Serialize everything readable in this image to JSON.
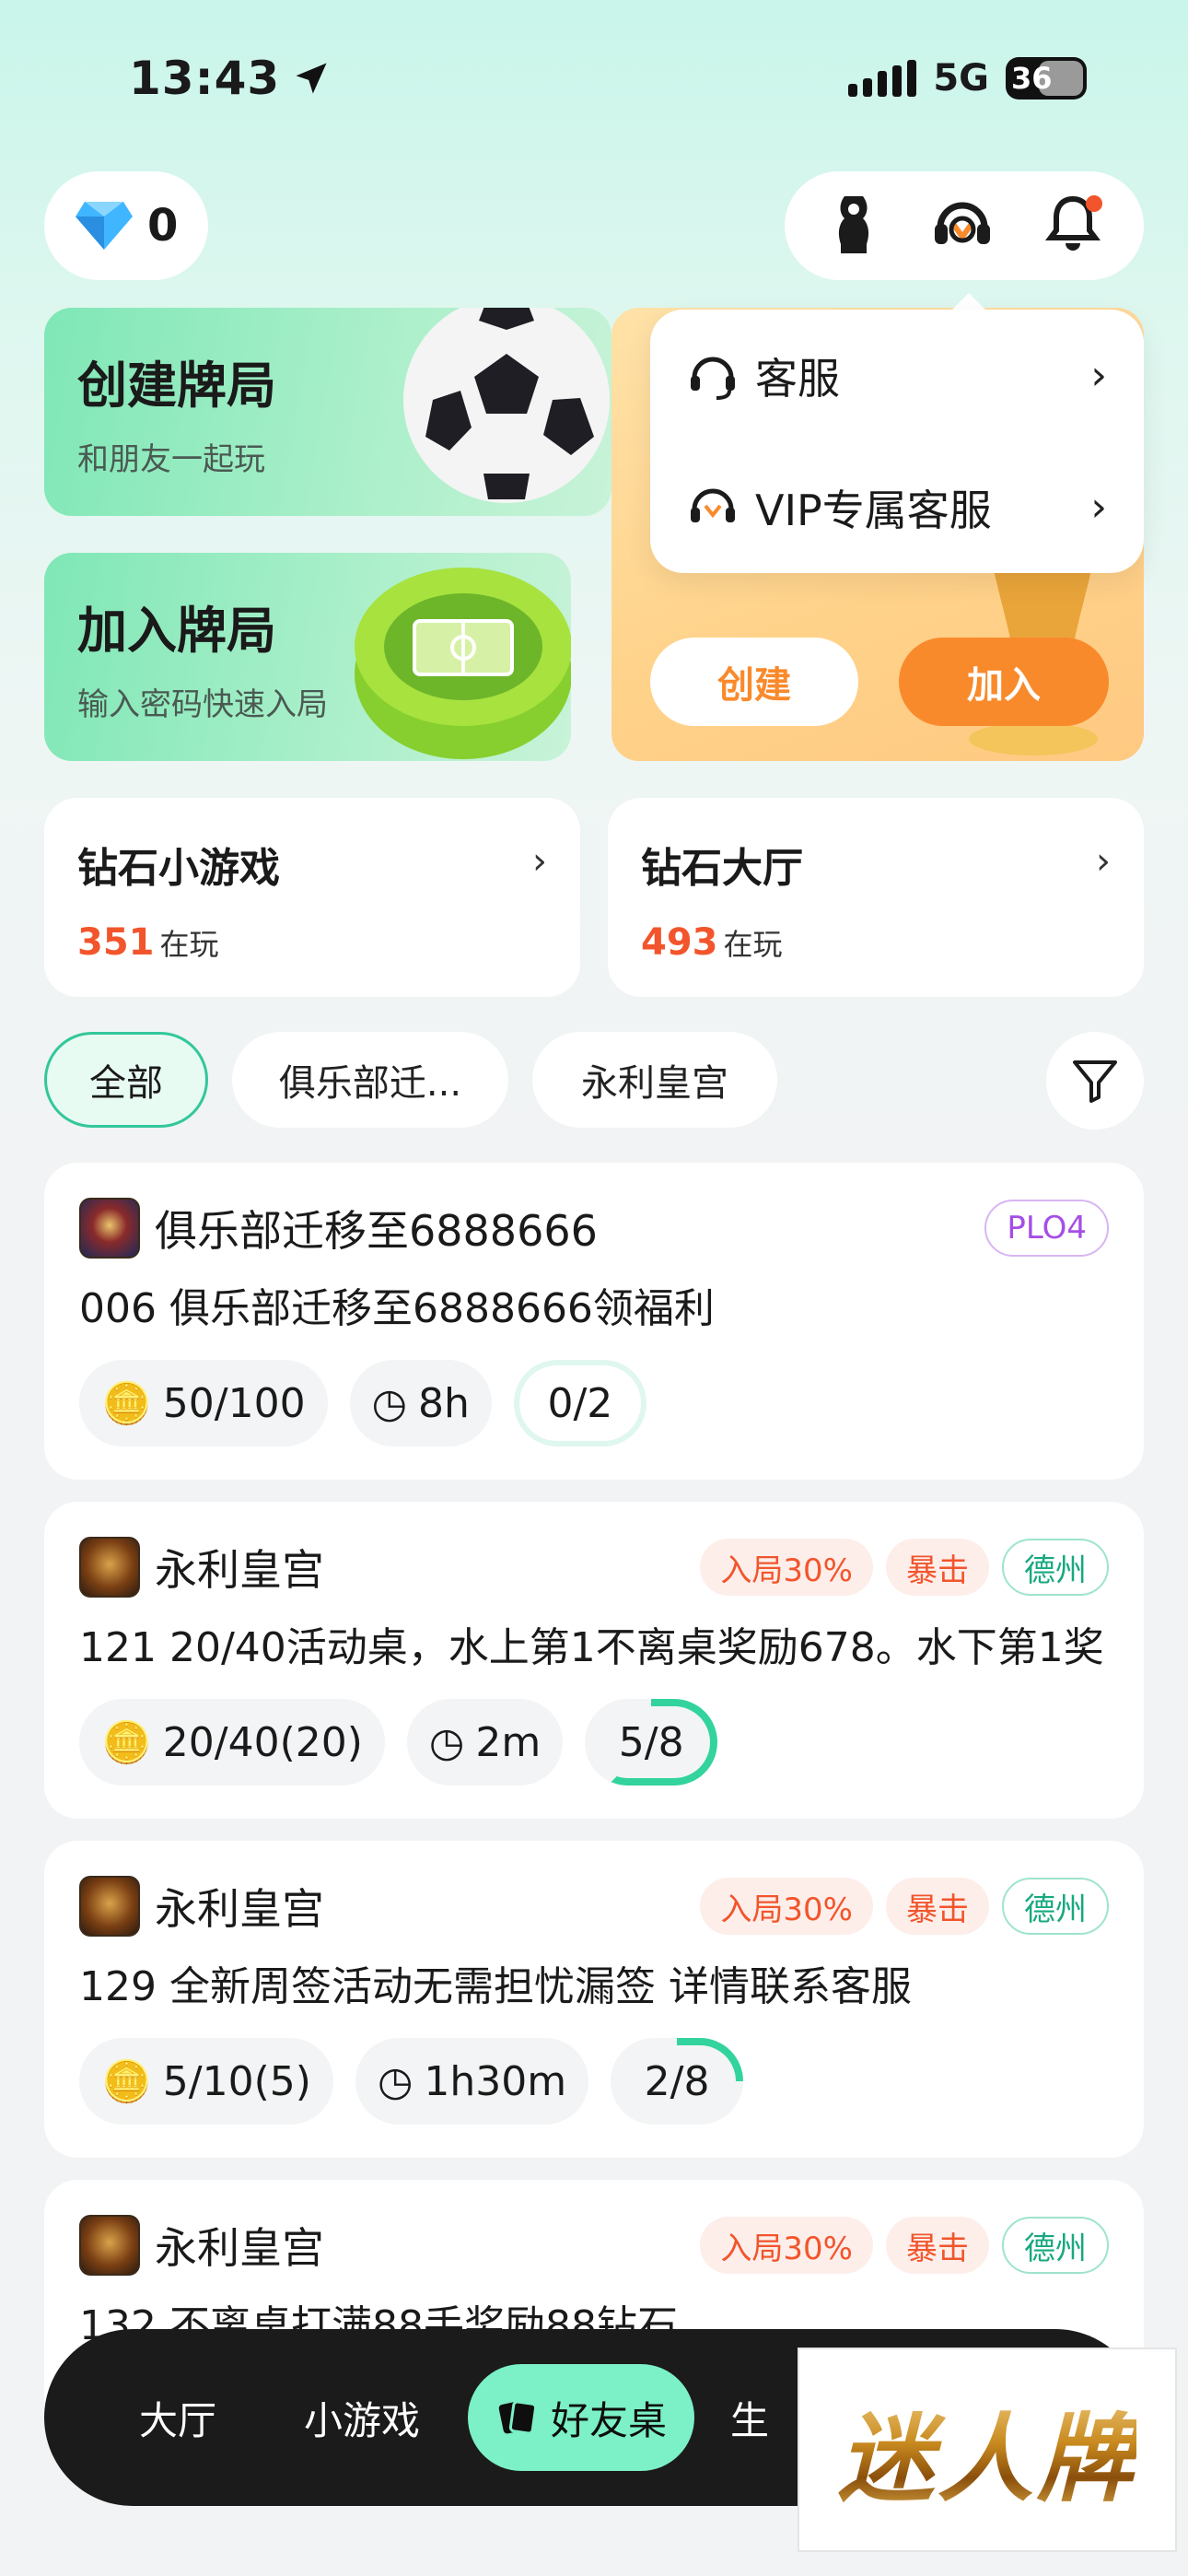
{
  "status_bar": {
    "time": "13:43",
    "network": "5G",
    "battery": "36"
  },
  "header": {
    "diamond_count": "0"
  },
  "banners": {
    "create": {
      "title": "创建牌局",
      "subtitle": "和朋友一起玩"
    },
    "join": {
      "title": "加入牌局",
      "subtitle": "输入密码快速入局"
    },
    "promo": {
      "create_label": "创建",
      "join_label": "加入"
    }
  },
  "dropdown": {
    "items": [
      {
        "label": "客服"
      },
      {
        "label": "VIP专属客服"
      }
    ]
  },
  "games": [
    {
      "title": "钻石小游戏",
      "count": "351",
      "suffix": "在玩"
    },
    {
      "title": "钻石大厅",
      "count": "493",
      "suffix": "在玩"
    }
  ],
  "filters": [
    "全部",
    "俱乐部迁...",
    "永利皇宫"
  ],
  "tables": [
    {
      "club": "俱乐部迁移至6888666",
      "tags": [
        "PLO4"
      ],
      "desc": "006 俱乐部迁移至6888666领福利",
      "blinds": "50/100",
      "time": "8h",
      "seats": "0/2",
      "fill": 0.0
    },
    {
      "club": "永利皇宫",
      "tags": [
        "入局30%",
        "暴击",
        "德州"
      ],
      "desc": "121 20/40活动桌，水上第1不离桌奖励678。水下第1奖",
      "blinds": "20/40(20)",
      "time": "2m",
      "seats": "5/8",
      "fill": 0.625
    },
    {
      "club": "永利皇宫",
      "tags": [
        "入局30%",
        "暴击",
        "德州"
      ],
      "desc": "129 全新周签活动无需担忧漏签 详情联系客服",
      "blinds": "5/10(5)",
      "time": "1h30m",
      "seats": "2/8",
      "fill": 0.25
    },
    {
      "club": "永利皇宫",
      "tags": [
        "入局30%",
        "暴击",
        "德州"
      ],
      "desc": "132 不离桌打满88手奖励88钻石",
      "blinds": "",
      "time": "",
      "seats": "",
      "fill": 0
    }
  ],
  "bottom_nav": [
    "大厅",
    "小游戏",
    "好友桌",
    "生"
  ],
  "watermark": "迷人牌",
  "colors": {
    "accent_green": "#7cf0c6",
    "orange": "#f98a2c",
    "red_count": "#f2552c"
  }
}
